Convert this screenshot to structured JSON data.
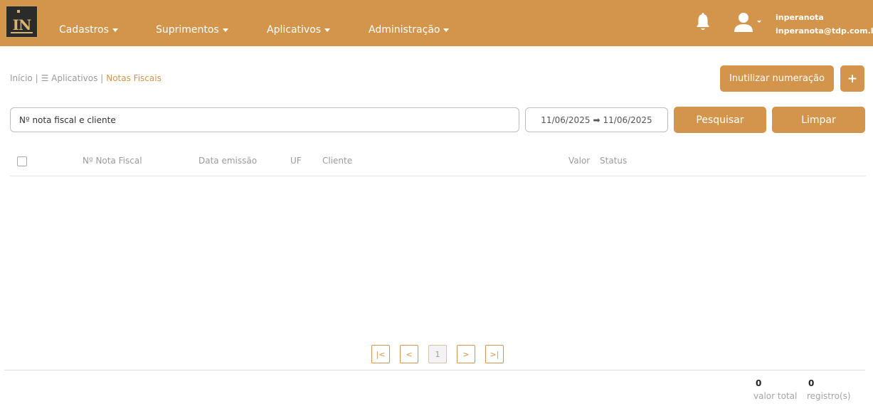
{
  "header": {
    "nav": [
      {
        "label": "Cadastros"
      },
      {
        "label": "Suprimentos"
      },
      {
        "label": "Aplicativos"
      },
      {
        "label": "Administração"
      }
    ],
    "user": {
      "name": "inperanota",
      "email": "inperanota@tdp.com.br"
    }
  },
  "breadcrumb": {
    "home": "Início |",
    "apps": "☰ Aplicativos |",
    "current": "Notas Fiscais"
  },
  "actions": {
    "inutilizar": "Inutilizar numeração",
    "add": "+"
  },
  "search": {
    "placeholder": "Nº nota fiscal e cliente",
    "date_start": "11/06/2025",
    "date_sep": "➡",
    "date_end": "11/06/2025",
    "search_label": "Pesquisar",
    "clear_label": "Limpar"
  },
  "table": {
    "columns": [
      "Nº Nota Fiscal",
      "Data emissão",
      "UF",
      "Cliente",
      "Valor",
      "Status"
    ]
  },
  "pagination": {
    "first": "|<",
    "prev": "<",
    "page": "1",
    "next": ">",
    "last": ">|"
  },
  "summary": {
    "total_value": "0",
    "total_value_label": "valor total",
    "records": "0",
    "records_label": "registro(s)"
  },
  "colors": {
    "accent": "#D2954B",
    "logo_bg": "#2b2b2b"
  }
}
